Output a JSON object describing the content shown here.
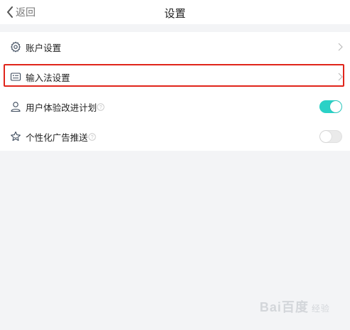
{
  "header": {
    "back_label": "返回",
    "title": "设置"
  },
  "settings": [
    {
      "label": "账户设置",
      "icon": "gear-icon",
      "control": "chevron"
    },
    {
      "label": "输入法设置",
      "icon": "keyboard-card-icon",
      "control": "chevron",
      "highlighted": true
    },
    {
      "label": "用户体验改进计划",
      "icon": "user-icon",
      "control": "toggle",
      "toggle_on": true,
      "help": true
    },
    {
      "label": "个性化广告推送",
      "icon": "star-icon",
      "control": "toggle",
      "toggle_on": false,
      "help": true
    }
  ],
  "colors": {
    "accent": "#2ad1c6",
    "highlight_border": "#e0251b",
    "background": "#f3f4f6"
  },
  "watermark": {
    "main": "Bai百度",
    "sub": "经验"
  }
}
